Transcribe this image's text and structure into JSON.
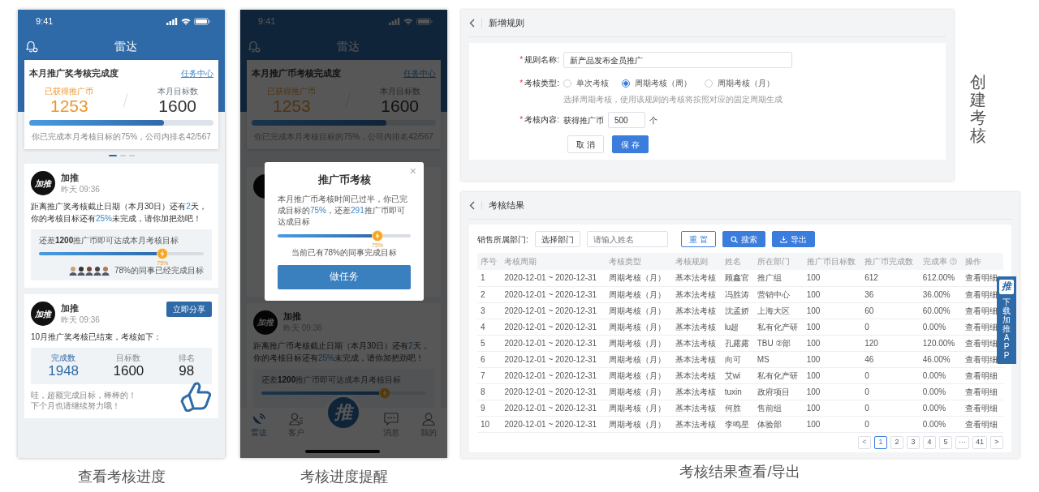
{
  "phones": [
    {
      "caption": "查看考核进度",
      "time": "9:41",
      "title": "雷达",
      "dimmed": false,
      "summary": {
        "title": "本月推广奖考核完成度",
        "link": "任务中心",
        "earned_label": "已获得推广币",
        "earned": "1253",
        "target_label": "本月目标数",
        "target": "1600",
        "level": 0.73,
        "note": "你已完成本月考核目标的75%，公司内排名42/567"
      },
      "pager": [
        {
          "selected": true
        },
        {
          "selected": false
        },
        {
          "selected": false
        }
      ],
      "posts": [
        {
          "kind": "progress",
          "avatar": "加推",
          "author": "加推",
          "time": "昨天 09:36",
          "message": "距离推广奖考核截止日期（本月30日）还有**2**天，你的考核目标还有**25%**未完成，请你加把劲吧！",
          "gap_text": "还差**1200**推广币即可达成本月考核目标",
          "level": 0.75,
          "marker": "75%",
          "peers": "78%的同事已经完成目标"
        },
        {
          "kind": "result",
          "avatar": "加推",
          "author": "加推",
          "time": "昨天 09:36",
          "share": "立即分享",
          "message": "10月推广奖考核已结束，考核如下：",
          "stats": [
            {
              "label": "完成数",
              "value": "1948",
              "highlight": true
            },
            {
              "label": "目标数",
              "value": "1600",
              "highlight": false
            },
            {
              "label": "排名",
              "value": "98",
              "highlight": false
            }
          ],
          "footer": [
            "哇，超额完成目标，棒棒的！",
            "下个月也请继续努力哦！"
          ]
        }
      ]
    },
    {
      "caption": "考核进度提醒",
      "time": "9:41",
      "title": "雷达",
      "dimmed": true,
      "summary": {
        "title": "本月推广币考核完成度",
        "link": "任务中心",
        "earned_label": "已获得推广币",
        "earned": "1253",
        "target_label": "本月目标数",
        "target": "1600",
        "level": 0.73,
        "note": "你已完成本月考核目标的75%，公司内排名42/567"
      },
      "posts": [
        {
          "kind": "covered"
        },
        {
          "kind": "progress",
          "avatar": "加推",
          "author": "加推",
          "time": "昨天 09:36",
          "message": "距离推广币考核截止日期（本月30日）还有**2**天，你的考核目标还有**25%**未完成，请你加把劲吧！",
          "gap_text": "还差**1200**推广币即可达成本月考核目标",
          "level": 0.75
        }
      ],
      "tabbar": [
        {
          "kind": "tab",
          "label": "雷达",
          "selected": true
        },
        {
          "kind": "tab",
          "label": "客户",
          "selected": false
        },
        {
          "kind": "center",
          "label": "推"
        },
        {
          "kind": "tab",
          "label": "消息",
          "selected": false
        },
        {
          "kind": "tab",
          "label": "我的",
          "selected": false
        }
      ],
      "modal": {
        "close": "×",
        "title": "推广币考核",
        "message": "本月推广币考核时间已过半，你已完成目标的**75%**，还差**291**推广币即可达成目标",
        "level": 0.75,
        "marker": "75%",
        "note": "当前已有78%的同事完成目标",
        "button": "做任务"
      }
    }
  ],
  "form": {
    "title": "新增规则",
    "fields": [
      {
        "kind": "text",
        "marker": "*",
        "label": "规则名称:",
        "value": "新产品发布全员推广"
      },
      {
        "kind": "radio",
        "marker": "*",
        "label": "考核类型:",
        "options": [
          {
            "label": "单次考核",
            "selected": false
          },
          {
            "label": "周期考核（周）",
            "selected": true
          },
          {
            "label": "周期考核（月）",
            "selected": false
          }
        ],
        "hint": "选择周期考核，使用该规则的考核将按照对应的固定周期生成"
      },
      {
        "kind": "amount",
        "marker": "*",
        "label": "考核内容:",
        "prefix": "获得推广币",
        "value": "500",
        "suffix": "个"
      }
    ],
    "buttons": [
      {
        "label": "取 消",
        "primary": false
      },
      {
        "label": "保 存",
        "primary": true
      }
    ]
  },
  "side_label": "创建考核",
  "results": {
    "title": "考核结果",
    "filter_label": "销售所属部门:",
    "select": "选择部门",
    "name_placeholder": "请输入姓名",
    "buttons": [
      {
        "kind": "reset",
        "label": "重 置"
      },
      {
        "kind": "search",
        "label": "搜索"
      },
      {
        "kind": "export",
        "label": "导出"
      }
    ],
    "columns": [
      {
        "label": "序号",
        "kind": "text"
      },
      {
        "label": "考核周期",
        "kind": "text"
      },
      {
        "label": "考核类型",
        "kind": "text"
      },
      {
        "label": "考核规则",
        "kind": "text"
      },
      {
        "label": "姓名",
        "kind": "text"
      },
      {
        "label": "所在部门",
        "kind": "text"
      },
      {
        "label": "推广币目标数",
        "kind": "text"
      },
      {
        "label": "推广币完成数",
        "kind": "text"
      },
      {
        "label": "完成率",
        "kind": "help"
      },
      {
        "label": "操作",
        "kind": "action"
      }
    ],
    "rows": [
      [
        "1",
        "2020-12-01 ~ 2020-12-31",
        "周期考核（月）",
        "基本法考核",
        "顾鑫官",
        "推广组",
        "100",
        "612",
        "612.00%",
        "查看明细"
      ],
      [
        "2",
        "2020-12-01 ~ 2020-12-31",
        "周期考核（月）",
        "基本法考核",
        "冯胜涛",
        "营销中心",
        "100",
        "36",
        "36.00%",
        "查看明细"
      ],
      [
        "3",
        "2020-12-01 ~ 2020-12-31",
        "周期考核（月）",
        "基本法考核",
        "沈孟娇",
        "上海大区",
        "100",
        "60",
        "60.00%",
        "查看明细"
      ],
      [
        "4",
        "2020-12-01 ~ 2020-12-31",
        "周期考核（月）",
        "基本法考核",
        "lu超",
        "私有化产研",
        "100",
        "0",
        "0.00%",
        "查看明细"
      ],
      [
        "5",
        "2020-12-01 ~ 2020-12-31",
        "周期考核（月）",
        "基本法考核",
        "孔露露",
        "TBU ②部",
        "100",
        "120",
        "120.00%",
        "查看明细"
      ],
      [
        "6",
        "2020-12-01 ~ 2020-12-31",
        "周期考核（月）",
        "基本法考核",
        "向可",
        "MS",
        "100",
        "46",
        "46.00%",
        "查看明细"
      ],
      [
        "7",
        "2020-12-01 ~ 2020-12-31",
        "周期考核（月）",
        "基本法考核",
        "艾wi",
        "私有化产研",
        "100",
        "0",
        "0.00%",
        "查看明细"
      ],
      [
        "8",
        "2020-12-01 ~ 2020-12-31",
        "周期考核（月）",
        "基本法考核",
        "tuxin",
        "政府项目",
        "100",
        "0",
        "0.00%",
        "查看明细"
      ],
      [
        "9",
        "2020-12-01 ~ 2020-12-31",
        "周期考核（月）",
        "基本法考核",
        "何胜",
        "售前组",
        "100",
        "0",
        "0.00%",
        "查看明细"
      ],
      [
        "10",
        "2020-12-01 ~ 2020-12-31",
        "周期考核（月）",
        "基本法考核",
        "李鸣星",
        "体验部",
        "100",
        "0",
        "0.00%",
        "查看明细"
      ]
    ],
    "pagination": {
      "prev": "<",
      "next": ">",
      "prev_disabled": true,
      "pages": [
        {
          "label": "1",
          "selected": true
        },
        {
          "label": "2",
          "selected": false
        },
        {
          "label": "3",
          "selected": false
        },
        {
          "label": "4",
          "selected": false
        },
        {
          "label": "5",
          "selected": false
        },
        {
          "label": "···",
          "selected": false
        },
        {
          "label": "41",
          "selected": false
        }
      ]
    },
    "download_tab": {
      "logo": "推",
      "label": "下载加推APP"
    }
  },
  "results_caption": "考核结果查看/导出"
}
